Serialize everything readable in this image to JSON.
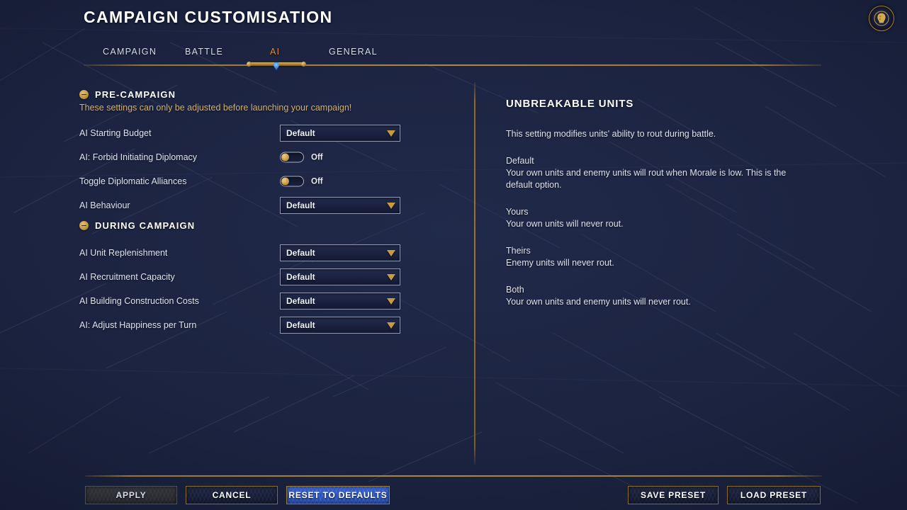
{
  "header": {
    "title": "CAMPAIGN CUSTOMISATION",
    "emblem_icon": "faction-head-emblem-icon"
  },
  "tabs": [
    {
      "label": "CAMPAIGN",
      "active": false
    },
    {
      "label": "BATTLE",
      "active": false
    },
    {
      "label": "AI",
      "active": true
    },
    {
      "label": "GENERAL",
      "active": false
    }
  ],
  "sections": [
    {
      "title": "PRE-CAMPAIGN",
      "collapse_icon": "collapse-minus-icon",
      "note": "These settings can only be adjusted before launching your campaign!",
      "rows": [
        {
          "label": "AI Starting Budget",
          "control": "dropdown",
          "value": "Default"
        },
        {
          "label": "AI: Forbid Initiating Diplomacy",
          "control": "toggle",
          "state": "Off",
          "on": false
        },
        {
          "label": "Toggle Diplomatic Alliances",
          "control": "toggle",
          "state": "Off",
          "on": false
        },
        {
          "label": "AI Behaviour",
          "control": "dropdown",
          "value": "Default"
        }
      ]
    },
    {
      "title": "DURING CAMPAIGN",
      "collapse_icon": "collapse-minus-icon",
      "note": "",
      "rows": [
        {
          "label": "AI Unit Replenishment",
          "control": "dropdown",
          "value": "Default"
        },
        {
          "label": "AI Recruitment Capacity",
          "control": "dropdown",
          "value": "Default"
        },
        {
          "label": "AI Building Construction Costs",
          "control": "dropdown",
          "value": "Default"
        },
        {
          "label": "AI: Adjust Happiness per Turn",
          "control": "dropdown",
          "value": "Default"
        }
      ]
    }
  ],
  "info": {
    "title": "UNBREAKABLE UNITS",
    "lead": "This setting modifies units' ability to rout during battle.",
    "options": [
      {
        "name": "Default",
        "desc": "Your own units and enemy units will rout when Morale is low. This is the default option."
      },
      {
        "name": "Yours",
        "desc": "Your own units will never rout."
      },
      {
        "name": "Theirs",
        "desc": "Enemy units will never rout."
      },
      {
        "name": "Both",
        "desc": "Your own units and enemy units will never rout."
      }
    ]
  },
  "footer": {
    "apply_label": "APPLY",
    "cancel_label": "CANCEL",
    "reset_label": "RESET TO DEFAULTS",
    "save_preset_label": "SAVE PRESET",
    "load_preset_label": "LOAD PRESET"
  },
  "colors": {
    "background": "#1b2340",
    "gold": "#b08a38",
    "accent_active_tab": "#e08a3c",
    "warning_text": "#d8b264",
    "primary_button": "#2b56c4",
    "text": "#e8ecf5"
  }
}
